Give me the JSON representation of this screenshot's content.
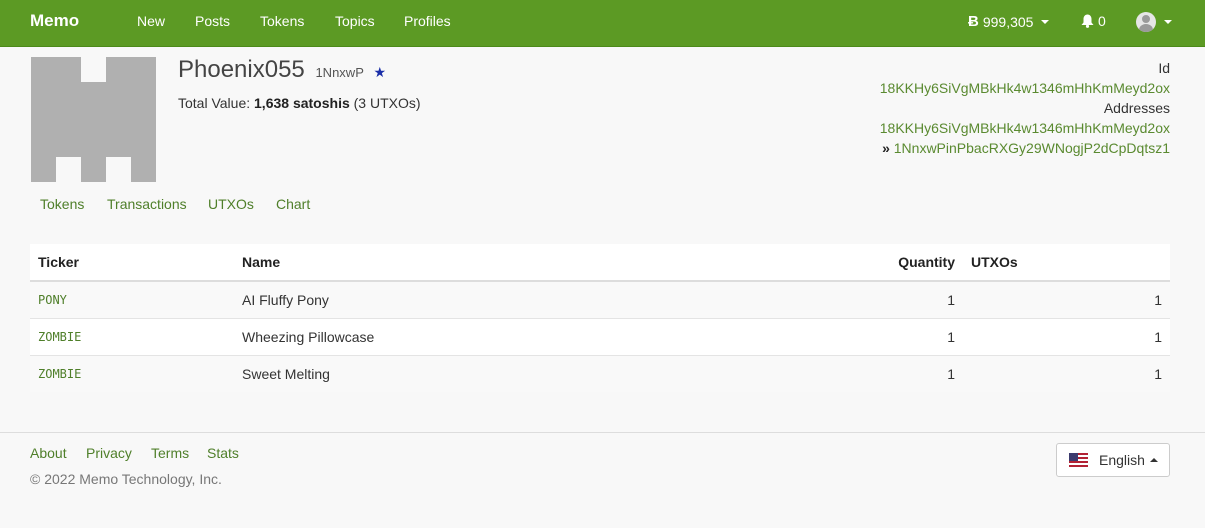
{
  "nav": {
    "brand": "Memo",
    "links": [
      "New",
      "Posts",
      "Tokens",
      "Topics",
      "Profiles"
    ],
    "balance": "999,305",
    "notifications": "0"
  },
  "profile": {
    "name": "Phoenix055",
    "short_address": "1NnxwP",
    "total_value_label": "Total Value:",
    "total_value": "1,638 satoshis",
    "utxo_count": "(3 UTXOs)",
    "id_label": "Id",
    "id": "18KKHy6SiVgMBkHk4w1346mHhKmMeyd2ox",
    "addresses_label": "Addresses",
    "addresses": [
      "18KKHy6SiVgMBkHk4w1346mHhKmMeyd2ox",
      "1NnxwPinPbacRXGy29WNogjP2dCpDqtsz1"
    ]
  },
  "tabs": [
    "Tokens",
    "Transactions",
    "UTXOs",
    "Chart"
  ],
  "table": {
    "headers": [
      "Ticker",
      "Name",
      "Quantity",
      "UTXOs"
    ],
    "rows": [
      {
        "ticker": "PONY",
        "name": "AI Fluffy Pony",
        "quantity": "1",
        "utxos": "1"
      },
      {
        "ticker": "ZOMBIE",
        "name": "Wheezing Pillowcase",
        "quantity": "1",
        "utxos": "1"
      },
      {
        "ticker": "ZOMBIE",
        "name": "Sweet Melting",
        "quantity": "1",
        "utxos": "1"
      }
    ]
  },
  "footer": {
    "links": [
      "About",
      "Privacy",
      "Terms",
      "Stats"
    ],
    "copyright": "© 2022 Memo Technology, Inc.",
    "language": "English"
  },
  "colors": {
    "navbar": "#5c9a24",
    "link": "#4f7f2a",
    "star": "#1a2ea8"
  }
}
